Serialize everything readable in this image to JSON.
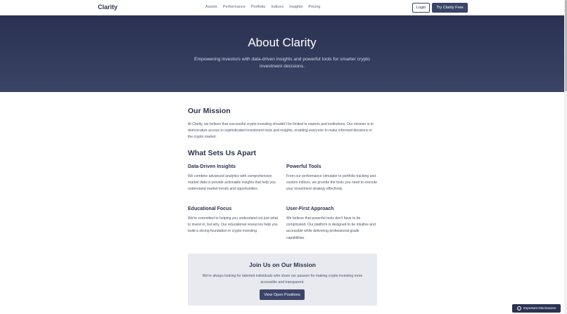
{
  "header": {
    "logo": "Clarity",
    "nav": [
      "Assets",
      "Performance",
      "Portfolio",
      "Indices",
      "Insights",
      "Pricing"
    ],
    "login_label": "Login",
    "try_label": "Try Clarity Free"
  },
  "hero": {
    "title": "About Clarity",
    "subtitle": "Empowering investors with data-driven insights and powerful tools for smarter crypto investment decisions."
  },
  "mission": {
    "heading": "Our Mission",
    "text": "At Clarity, we believe that successful crypto investing shouldn't be limited to experts and institutions. Our mission is to democratize access to sophisticated investment tools and insights, enabling everyone to make informed decisions in the crypto market."
  },
  "apart": {
    "heading": "What Sets Us Apart",
    "items": [
      {
        "title": "Data-Driven Insights",
        "text": "We combine advanced analytics with comprehensive market data to provide actionable insights that help you understand market trends and opportunities."
      },
      {
        "title": "Powerful Tools",
        "text": "From our performance simulator to portfolio tracking and custom indices, we provide the tools you need to execute your investment strategy effectively."
      },
      {
        "title": "Educational Focus",
        "text": "We're committed to helping you understand not just what to invest in, but why. Our educational resources help you build a strong foundation in crypto investing."
      },
      {
        "title": "User-First Approach",
        "text": "We believe that powerful tools don't have to be complicated. Our platform is designed to be intuitive and accessible while delivering professional-grade capabilities."
      }
    ]
  },
  "join": {
    "heading": "Join Us on Our Mission",
    "text": "We're always looking for talented individuals who share our passion for making crypto investing more accessible and transparent.",
    "button_label": "View Open Positions"
  },
  "disclosure": {
    "label": "Important Disclosures",
    "icon": "info-icon"
  }
}
